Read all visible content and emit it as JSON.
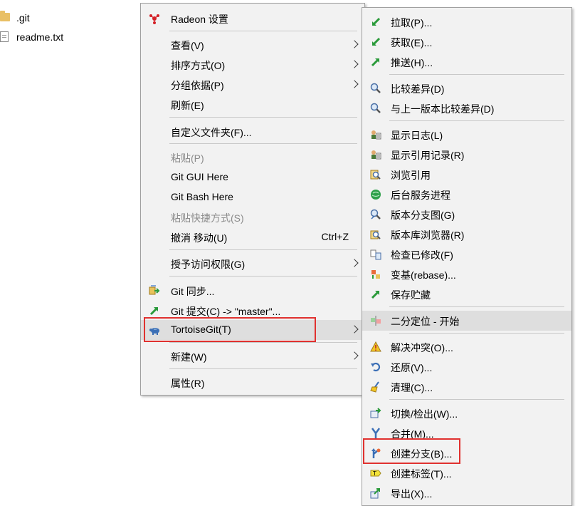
{
  "desktop": {
    "files": [
      {
        "name": ".git",
        "icon": "folder-icon"
      },
      {
        "name": "readme.txt",
        "icon": "text-file-icon"
      }
    ]
  },
  "context_menu": {
    "items": [
      {
        "label": "Radeon 设置",
        "icon": "radeon-icon"
      },
      {
        "label": "查看(V)",
        "submenu": true
      },
      {
        "label": "排序方式(O)",
        "submenu": true
      },
      {
        "label": "分组依据(P)",
        "submenu": true
      },
      {
        "label": "刷新(E)"
      },
      {
        "label": "自定义文件夹(F)..."
      },
      {
        "label": "粘贴(P)",
        "disabled": true
      },
      {
        "label": "Git GUI Here"
      },
      {
        "label": "Git Bash Here"
      },
      {
        "label": "粘贴快捷方式(S)",
        "disabled": true
      },
      {
        "label": "撤消 移动(U)",
        "shortcut": "Ctrl+Z"
      },
      {
        "label": "授予访问权限(G)",
        "submenu": true
      },
      {
        "label": "Git 同步...",
        "icon": "git-sync-icon"
      },
      {
        "label": "Git 提交(C) -> \"master\"...",
        "icon": "git-commit-icon"
      },
      {
        "label": "TortoiseGit(T)",
        "icon": "tortoisegit-icon",
        "submenu": true,
        "highlighted": true
      },
      {
        "label": "新建(W)",
        "submenu": true
      },
      {
        "label": "属性(R)"
      }
    ]
  },
  "tortoisegit_submenu": {
    "items": [
      {
        "label": "拉取(P)...",
        "icon": "pull-icon"
      },
      {
        "label": "获取(E)...",
        "icon": "fetch-icon"
      },
      {
        "label": "推送(H)...",
        "icon": "push-icon"
      },
      {
        "label": "比较差异(D)",
        "icon": "diff-icon"
      },
      {
        "label": "与上一版本比较差异(D)",
        "icon": "diff-previous-icon"
      },
      {
        "label": "显示日志(L)",
        "icon": "show-log-icon"
      },
      {
        "label": "显示引用记录(R)",
        "icon": "reflog-icon"
      },
      {
        "label": "浏览引用",
        "icon": "browse-references-icon"
      },
      {
        "label": "后台服务进程",
        "icon": "daemon-icon"
      },
      {
        "label": "版本分支图(G)",
        "icon": "revision-graph-icon"
      },
      {
        "label": "版本库浏览器(R)",
        "icon": "repo-browser-icon"
      },
      {
        "label": "检查已修改(F)",
        "icon": "check-modifications-icon"
      },
      {
        "label": "变基(rebase)...",
        "icon": "rebase-icon"
      },
      {
        "label": "保存贮藏",
        "icon": "stash-save-icon"
      },
      {
        "label": "二分定位 - 开始",
        "icon": "bisect-icon",
        "highlighted": true
      },
      {
        "label": "解决冲突(O)...",
        "icon": "resolve-icon"
      },
      {
        "label": "还原(V)...",
        "icon": "revert-icon"
      },
      {
        "label": "清理(C)...",
        "icon": "cleanup-icon"
      },
      {
        "label": "切换/检出(W)...",
        "icon": "switch-checkout-icon"
      },
      {
        "label": "合并(M)...",
        "icon": "merge-icon"
      },
      {
        "label": "创建分支(B)...",
        "icon": "create-branch-icon",
        "boxed": true
      },
      {
        "label": "创建标签(T)...",
        "icon": "create-tag-icon"
      },
      {
        "label": "导出(X)...",
        "icon": "export-icon"
      }
    ]
  },
  "colors": {
    "menu_bg": "#f2f2f2",
    "highlight_bg": "#dedede",
    "annotation_red": "#e0312f",
    "disabled_text": "#8c8c8c"
  }
}
